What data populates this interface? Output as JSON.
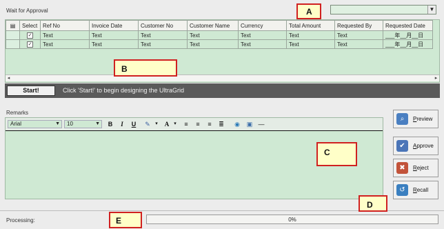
{
  "header": {
    "title": "Wait for Approval"
  },
  "grid": {
    "columns": [
      "",
      "Select",
      "Ref No",
      "Invoice Date",
      "Customer No",
      "Customer Name",
      "Currency",
      "Total Amount",
      "Requested By",
      "Requested Date"
    ],
    "rows": [
      {
        "selected": true,
        "cells": [
          "Text",
          "Text",
          "Text",
          "Text",
          "Text",
          "Text",
          "Text",
          "___年__月__日"
        ]
      },
      {
        "selected": true,
        "cells": [
          "Text",
          "Text",
          "Text",
          "Text",
          "Text",
          "Text",
          "Text",
          "___年__月__日"
        ]
      }
    ]
  },
  "start_bar": {
    "button_label": "Start!",
    "hint": "Click 'Start!' to begin designing the UltraGrid"
  },
  "remarks": {
    "label": "Remarks",
    "font_name": "Arial",
    "font_size": "10"
  },
  "side_buttons": [
    {
      "label_underlined": "P",
      "label_rest": "review",
      "icon": "preview-icon",
      "color": "#4a7fc1"
    },
    {
      "label_underlined": "A",
      "label_rest": "pprove",
      "icon": "approve-user-icon",
      "color": "#4b75b8"
    },
    {
      "label_underlined": "R",
      "label_rest": "eject",
      "icon": "reject-user-icon",
      "color": "#c2533a"
    },
    {
      "label_underlined": "R",
      "label_rest": "ecall",
      "icon": "recall-icon",
      "color": "#3a7fc0"
    }
  ],
  "status": {
    "processing_label": "Processing:",
    "progress_text": "0%",
    "progress_value": 0
  },
  "callouts": {
    "a": "A",
    "b": "B",
    "c": "C",
    "d": "D",
    "e": "E"
  },
  "colors": {
    "grid_bg": "#cfe9d3",
    "callout_border": "#d02020",
    "callout_fill": "#ffffc8"
  }
}
